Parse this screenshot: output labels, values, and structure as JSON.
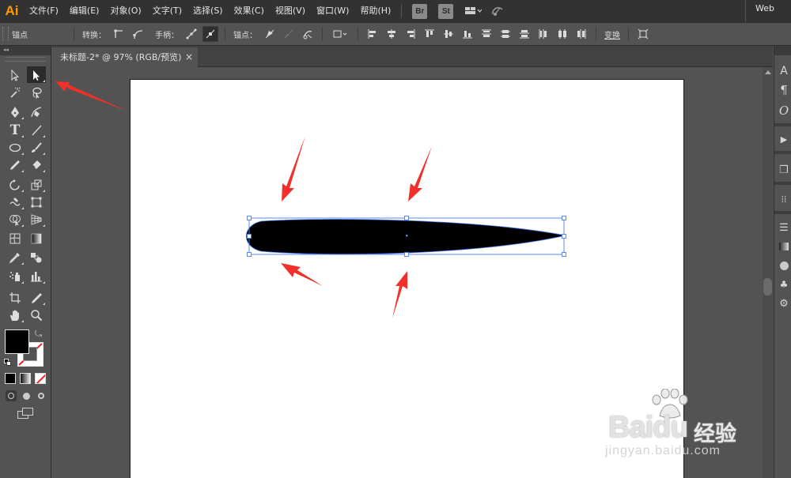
{
  "app": {
    "logo": "Ai"
  },
  "menu": [
    "文件(F)",
    "编辑(E)",
    "对象(O)",
    "文字(T)",
    "选择(S)",
    "效果(C)",
    "视图(V)",
    "窗口(W)",
    "帮助(H)"
  ],
  "menubar_icons": {
    "bridge": "Br",
    "stock": "St",
    "arrange": "arrange-documents-icon",
    "gpu": "gpu-performance-icon"
  },
  "workspace": "Web",
  "control_bar": {
    "selection_label": "锚点",
    "convert_label": "转换：",
    "handles_label": "手柄：",
    "anchors_label": "锚点：",
    "transform_label": "变换"
  },
  "document": {
    "tab_title": "未标题-2* @ 97% (RGB/预览)",
    "tab_close": "×"
  },
  "tools": [
    "selection-tool",
    "direct-selection-tool",
    "magic-wand-tool",
    "lasso-tool",
    "pen-tool",
    "curvature-tool",
    "type-tool",
    "line-segment-tool",
    "ellipse-tool",
    "paintbrush-tool",
    "pencil-tool",
    "eraser-tool",
    "rotate-tool",
    "scale-tool",
    "warp-tool",
    "free-transform-tool",
    "shape-builder-tool",
    "perspective-grid-tool",
    "mesh-tool",
    "gradient-tool",
    "eyedropper-tool",
    "blend-tool",
    "symbol-sprayer-tool",
    "column-graph-tool",
    "artboard-tool",
    "slice-tool",
    "hand-tool",
    "zoom-tool"
  ],
  "active_tool": "direct-selection-tool",
  "colors": {
    "fill": "#000000",
    "stroke": "none",
    "selection_blue": "#4a7cf7",
    "annotation_red": "#f2302b",
    "logo_orange": "#ff9a00"
  },
  "right_panels": [
    "character-panel-icon",
    "paragraph-panel-icon",
    "opentype-panel-icon",
    "actions-panel-icon",
    "artboards-panel-icon",
    "align-panel-icon",
    "layers-panel-icon",
    "gradient-panel-icon",
    "appearance-panel-icon",
    "symbols-panel-icon",
    "settings-panel-icon"
  ],
  "watermark": {
    "brand": "Baidu",
    "brand_cn": "经验",
    "url": "jingyan.baidu.com"
  }
}
